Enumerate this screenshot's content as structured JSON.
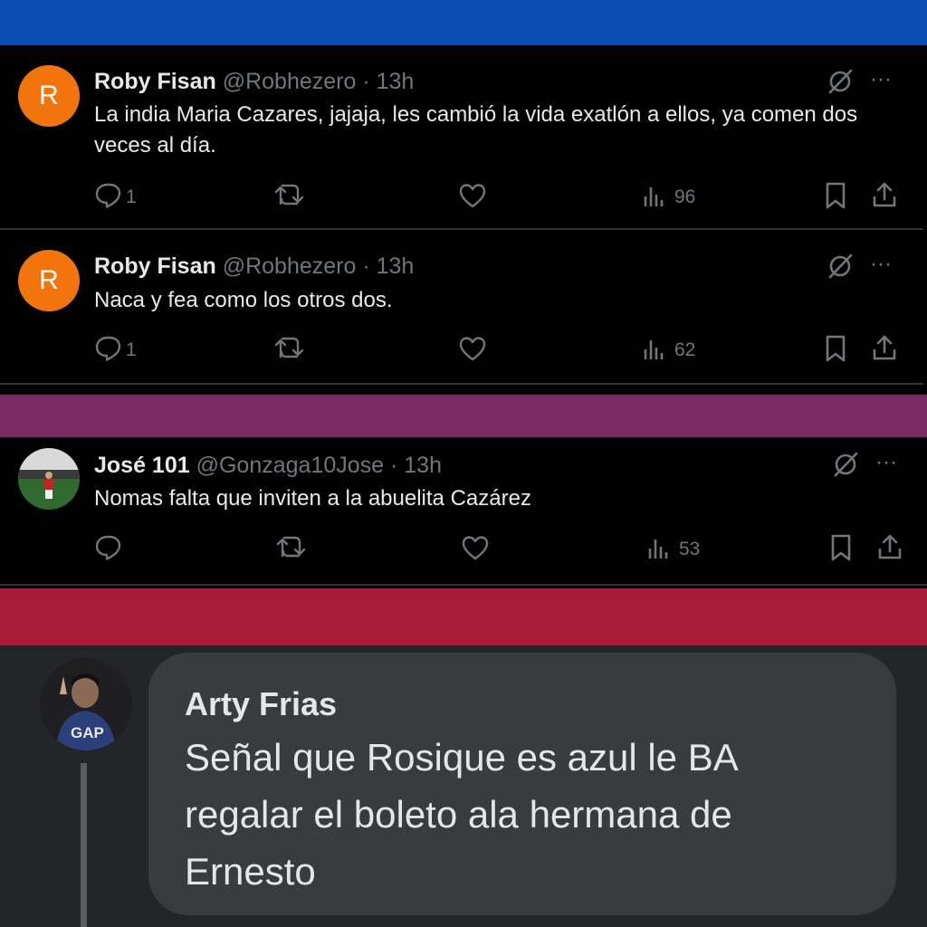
{
  "colors": {
    "top_band": "#0a4cb0",
    "purple_band": "#7a2b63",
    "crimson_band": "#a81c3a",
    "fb_background": "#242526",
    "fb_bubble": "#3a3b3c",
    "avatar_orange": "#f2740d",
    "icon_gray": "#71767b"
  },
  "tweets": [
    {
      "avatar_letter": "R",
      "name": "Roby Fisan",
      "meta": "@Robhezero · 13h",
      "text": "La india Maria Cazares, jajaja, les cambió la vida exatlón a ellos, ya comen dos veces al día.",
      "more": "···",
      "replies": "1",
      "views": "96"
    },
    {
      "avatar_letter": "R",
      "name": "Roby Fisan",
      "meta": "@Robhezero · 13h",
      "text": "Naca y fea como los otros dos.",
      "more": "···",
      "replies": "1",
      "views": "62"
    },
    {
      "name": "José 101",
      "meta": "@Gonzaga10Jose · 13h",
      "text": "Nomas falta que inviten a la abuelita Cazárez",
      "more": "···",
      "views": "53"
    }
  ],
  "facebook_comment": {
    "author": "Arty Frias",
    "text": "Señal que Rosique es azul le BA regalar el boleto ala hermana de Ernesto",
    "shirt_logo": "GAP"
  },
  "icons": {
    "reply": "reply-bubble-icon",
    "retweet": "retweet-icon",
    "like": "heart-icon",
    "views": "views-bar-icon",
    "bookmark": "bookmark-icon",
    "share": "share-icon",
    "grok": "grok-icon"
  }
}
